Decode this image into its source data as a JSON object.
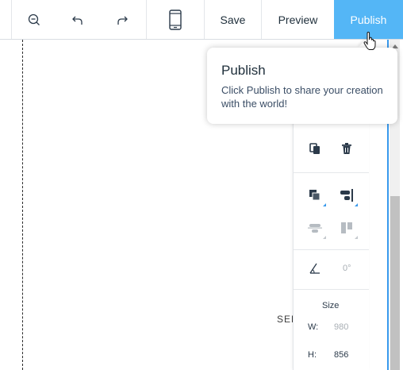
{
  "toolbar": {
    "zoom_out_icon": "zoom-out-icon",
    "undo_icon": "undo-icon",
    "redo_icon": "redo-icon",
    "mobile_icon": "mobile-view-icon",
    "save_label": "Save",
    "preview_label": "Preview",
    "publish_label": "Publish",
    "publish_color": "#54b6f6"
  },
  "tooltip": {
    "title": "Publish",
    "body": "Click Publish to share your creation with the world!"
  },
  "canvas": {
    "services_text": "SERVICES"
  },
  "panel": {
    "duplicate_icon": "duplicate-icon",
    "delete_icon": "trash-icon",
    "arrange_icon": "arrange-icon",
    "align_icon": "align-icon",
    "distribute_icon": "distribute-icon",
    "match_size_icon": "match-size-icon",
    "rotate_icon": "rotate-angle-icon",
    "rotation_value": "0°",
    "size_label": "Size",
    "width_label": "W:",
    "width_value": "980",
    "height_label": "H:",
    "height_value": "856"
  },
  "colors": {
    "accent": "#3899ec",
    "publish": "#54b6f6"
  }
}
